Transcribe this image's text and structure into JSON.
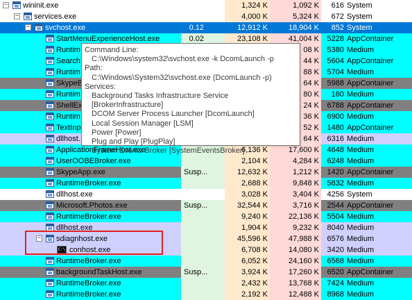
{
  "colors": {
    "blue_bg": "#00ffff",
    "selected": "#0078d7",
    "purple": "#d0d0ff",
    "gray": "#808080",
    "pink": "#ffd8d8",
    "green_col": "#e0f5e0",
    "orange_col": "#ffe8cc",
    "tan_col": "#f5f0d8",
    "highlight_box": "#e02020"
  },
  "rows": [
    {
      "name": "wininit.exe",
      "cpu": "",
      "cpu_note": "",
      "private": "1,324 K",
      "working": "1,092 K",
      "pid": "616",
      "integrity": "System",
      "indent": 0,
      "toggle": "minus",
      "icon": "proc",
      "bg": "white"
    },
    {
      "name": "services.exe",
      "cpu": "",
      "cpu_note": "",
      "private": "4,000 K",
      "working": "5,324 K",
      "pid": "672",
      "integrity": "System",
      "indent": 1,
      "toggle": "minus",
      "icon": "proc",
      "bg": "white"
    },
    {
      "name": "svchost.exe",
      "cpu": "0.12",
      "cpu_note": "",
      "private": "12,912 K",
      "working": "18,904 K",
      "pid": "852",
      "integrity": "System",
      "indent": 2,
      "toggle": "minus",
      "icon": "proc",
      "bg": "selected"
    },
    {
      "name": "StartMenuExperienceHost.exe",
      "cpu": "0.02",
      "cpu_note": "",
      "private": "23,108 K",
      "working": "41,004 K",
      "pid": "5228",
      "integrity": "AppContainer",
      "indent": 3,
      "toggle": "",
      "icon": "proc",
      "bg": "cyan"
    },
    {
      "name": "Runtim",
      "cpu": "",
      "cpu_note": "",
      "private": "",
      "working": "08 K",
      "pid": "5380",
      "integrity": "Medium",
      "indent": 3,
      "toggle": "",
      "icon": "proc",
      "bg": "cyan"
    },
    {
      "name": "Search",
      "cpu": "",
      "cpu_note": "",
      "private": "",
      "working": "44 K",
      "pid": "5604",
      "integrity": "AppContainer",
      "indent": 3,
      "toggle": "",
      "icon": "proc",
      "bg": "cyan"
    },
    {
      "name": "Runtim",
      "cpu": "",
      "cpu_note": "",
      "private": "",
      "working": "88 K",
      "pid": "5704",
      "integrity": "Medium",
      "indent": 3,
      "toggle": "",
      "icon": "proc",
      "bg": "cyan"
    },
    {
      "name": "SkypeB",
      "cpu": "",
      "cpu_note": "",
      "private": "",
      "working": "64 K",
      "pid": "5988",
      "integrity": "AppContainer",
      "indent": 3,
      "toggle": "",
      "icon": "proc",
      "bg": "gray"
    },
    {
      "name": "Runtim",
      "cpu": "",
      "cpu_note": "",
      "private": "",
      "working": "80 K",
      "pid": "160",
      "integrity": "Medium",
      "indent": 3,
      "toggle": "",
      "icon": "proc",
      "bg": "cyan"
    },
    {
      "name": "ShellEx",
      "cpu": "",
      "cpu_note": "",
      "private": "",
      "working": "24 K",
      "pid": "6788",
      "integrity": "AppContainer",
      "indent": 3,
      "toggle": "",
      "icon": "proc",
      "bg": "gray"
    },
    {
      "name": "Runtim",
      "cpu": "",
      "cpu_note": "",
      "private": "",
      "working": "36 K",
      "pid": "6900",
      "integrity": "Medium",
      "indent": 3,
      "toggle": "",
      "icon": "proc",
      "bg": "cyan"
    },
    {
      "name": "TextInp",
      "cpu": "",
      "cpu_note": "",
      "private": "",
      "working": "52 K",
      "pid": "1480",
      "integrity": "AppContainer",
      "indent": 3,
      "toggle": "",
      "icon": "proc",
      "bg": "cyan"
    },
    {
      "name": "dllhost.",
      "cpu": "",
      "cpu_note": "",
      "private": "",
      "working": "64 K",
      "pid": "6316",
      "integrity": "Medium",
      "indent": 3,
      "toggle": "",
      "icon": "proc",
      "bg": "purple"
    },
    {
      "name": "ApplicationFrameHost.exe",
      "cpu": "",
      "cpu_note": "",
      "private": "6,136 K",
      "working": "17,600 K",
      "pid": "4648",
      "integrity": "Medium",
      "indent": 3,
      "toggle": "",
      "icon": "proc",
      "bg": "cyan"
    },
    {
      "name": "UserOOBEBroker.exe",
      "cpu": "",
      "cpu_note": "",
      "private": "2,104 K",
      "working": "4,284 K",
      "pid": "6248",
      "integrity": "Medium",
      "indent": 3,
      "toggle": "",
      "icon": "proc",
      "bg": "cyan"
    },
    {
      "name": "SkypeApp.exe",
      "cpu": "",
      "cpu_note": "Susp...",
      "private": "12,632 K",
      "working": "1,212 K",
      "pid": "1420",
      "integrity": "AppContainer",
      "indent": 3,
      "toggle": "",
      "icon": "proc",
      "bg": "gray"
    },
    {
      "name": "RuntimeBroker.exe",
      "cpu": "",
      "cpu_note": "",
      "private": "2,688 K",
      "working": "9,848 K",
      "pid": "5832",
      "integrity": "Medium",
      "indent": 3,
      "toggle": "",
      "icon": "proc",
      "bg": "cyan"
    },
    {
      "name": "dllhost.exe",
      "cpu": "",
      "cpu_note": "",
      "private": "3,028 K",
      "working": "3,404 K",
      "pid": "4256",
      "integrity": "System",
      "indent": 3,
      "toggle": "",
      "icon": "proc",
      "bg": "white"
    },
    {
      "name": "Microsoft.Photos.exe",
      "cpu": "",
      "cpu_note": "Susp...",
      "private": "32,544 K",
      "working": "3,716 K",
      "pid": "2544",
      "integrity": "AppContainer",
      "indent": 3,
      "toggle": "",
      "icon": "proc",
      "bg": "gray"
    },
    {
      "name": "RuntimeBroker.exe",
      "cpu": "",
      "cpu_note": "",
      "private": "9,240 K",
      "working": "22,136 K",
      "pid": "5504",
      "integrity": "Medium",
      "indent": 3,
      "toggle": "",
      "icon": "proc",
      "bg": "cyan"
    },
    {
      "name": "dllhost.exe",
      "cpu": "",
      "cpu_note": "",
      "private": "1,904 K",
      "working": "9,232 K",
      "pid": "8040",
      "integrity": "Medium",
      "indent": 3,
      "toggle": "",
      "icon": "proc",
      "bg": "purple"
    },
    {
      "name": "sdiagnhost.exe",
      "cpu": "",
      "cpu_note": "",
      "private": "45,596 K",
      "working": "47,988 K",
      "pid": "6576",
      "integrity": "Medium",
      "indent": 3,
      "toggle": "minus",
      "icon": "proc",
      "bg": "purple"
    },
    {
      "name": "conhost.exe",
      "cpu": "",
      "cpu_note": "",
      "private": "6,708 K",
      "working": "14,080 K",
      "pid": "3420",
      "integrity": "Medium",
      "indent": 4,
      "toggle": "",
      "icon": "cmd",
      "bg": "purple"
    },
    {
      "name": "RuntimeBroker.exe",
      "cpu": "",
      "cpu_note": "",
      "private": "6,052 K",
      "working": "24,160 K",
      "pid": "6568",
      "integrity": "Medium",
      "indent": 3,
      "toggle": "",
      "icon": "proc",
      "bg": "cyan"
    },
    {
      "name": "backgroundTaskHost.exe",
      "cpu": "",
      "cpu_note": "Susp...",
      "private": "3,924 K",
      "working": "17,260 K",
      "pid": "6520",
      "integrity": "AppContainer",
      "indent": 3,
      "toggle": "",
      "icon": "proc",
      "bg": "gray"
    },
    {
      "name": "RuntimeBroker.exe",
      "cpu": "",
      "cpu_note": "",
      "private": "2,432 K",
      "working": "13,768 K",
      "pid": "7424",
      "integrity": "Medium",
      "indent": 3,
      "toggle": "",
      "icon": "proc",
      "bg": "cyan"
    },
    {
      "name": "RuntimeBroker.exe",
      "cpu": "",
      "cpu_note": "",
      "private": "2,192 K",
      "working": "12,488 K",
      "pid": "8968",
      "integrity": "Medium",
      "indent": 3,
      "toggle": "",
      "icon": "proc",
      "bg": "cyan"
    }
  ],
  "tooltip": {
    "command_line_label": "Command Line:",
    "command_line": "C:\\Windows\\system32\\svchost.exe -k DcomLaunch -p",
    "path_label": "Path:",
    "path": "C:\\Windows\\System32\\svchost.exe (DcomLaunch -p)",
    "services_label": "Services:",
    "services": [
      "Background Tasks Infrastructure Service [BrokerInfrastructure]",
      "DCOM Server Process Launcher [DcomLaunch]",
      "Local Session Manager [LSM]",
      "Power [Power]",
      "Plug and Play [PlugPlay]",
      "System Events Broker [SystemEventsBroker]"
    ]
  }
}
